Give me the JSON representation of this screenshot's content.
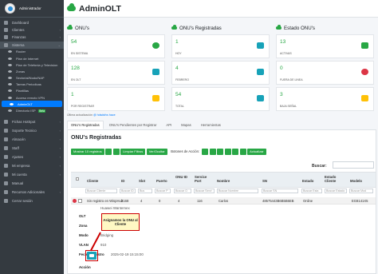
{
  "sidebar": {
    "username": "Administrador",
    "items": [
      {
        "label": "Dashboard",
        "arrow": ""
      },
      {
        "label": "Clientes",
        "arrow": "‹"
      },
      {
        "label": "Finanzas",
        "arrow": "‹"
      },
      {
        "label": "Sistema",
        "arrow": "⌄"
      }
    ],
    "subitems": [
      "Router",
      "Plan de Internet",
      "Plan de Telefonia y Television",
      "Zonas",
      "Sectorial/Nodo/NAP",
      "Tareas Periodicas",
      "Plantillas",
      "Acceso remoto VPN",
      "AdminOLT",
      "Directorio ISP"
    ],
    "directorio_badge": "Beta",
    "bottom_items": [
      {
        "label": "Fichas HotSpot",
        "arrow": "‹"
      },
      {
        "label": "Soporte Tecnico",
        "arrow": "‹"
      },
      {
        "label": "Almacén",
        "arrow": "‹"
      },
      {
        "label": "Staff",
        "arrow": "‹"
      },
      {
        "label": "Ajustes",
        "arrow": "‹"
      },
      {
        "label": "Mi empresa",
        "arrow": "‹"
      },
      {
        "label": "Mi cuenta",
        "arrow": "‹"
      },
      {
        "label": "Manual",
        "arrow": ""
      },
      {
        "label": "Recursos Adicionales",
        "arrow": "‹"
      },
      {
        "label": "Cerrar sesión",
        "arrow": ""
      }
    ]
  },
  "header": {
    "title": "AdminOLT"
  },
  "sections": {
    "onus": {
      "title": "ONU's",
      "cards": [
        {
          "num": "54",
          "label": "En sistema",
          "color": "#28a745"
        },
        {
          "num": "128",
          "label": "En OLT",
          "color": "#28a745"
        },
        {
          "num": "1",
          "label": "Por registrar",
          "color": "#28a745"
        }
      ]
    },
    "registradas": {
      "title": "ONU's Registradas",
      "cards": [
        {
          "num": "1",
          "label": "Hoy",
          "color": "#28a745"
        },
        {
          "num": "4",
          "label": "Febrero",
          "color": "#28a745"
        },
        {
          "num": "54",
          "label": "Total",
          "color": "#28a745"
        }
      ]
    },
    "estado": {
      "title": "Estado ONU's",
      "cards": [
        {
          "num": "13",
          "label": "Activas",
          "color": "#28a745"
        },
        {
          "num": "0",
          "label": "Fuera de linea",
          "color": "#28a745"
        },
        {
          "num": "3",
          "label": "Baja señal",
          "color": "#28a745"
        }
      ]
    }
  },
  "refresh": {
    "prefix": "Última actualización ",
    "link": "@ hdsdsfvs  hace"
  },
  "tabs": [
    "ONU's Registradas",
    "ONU's Pendientes por Registrar",
    "API",
    "Mapas",
    "Herramientas"
  ],
  "panel": {
    "title": "ONU's Registradas",
    "buttons": {
      "show": "Mostrar 10 registros",
      "clear": "Limpiar Filtros",
      "showhide": "Ver/Ocultar",
      "actions_label": "Botones de Acción:",
      "update": "Actualizar"
    },
    "search_label": "Buscar:",
    "headers": [
      "Cliente",
      "ID",
      "Slot",
      "Puerto",
      "ONU ID",
      "Service Port",
      "Nombre",
      "SN",
      "Estado",
      "Estado Cliente",
      "Modelo"
    ],
    "filters": [
      "Buscar Cliente",
      "Buscar ID",
      "Bus",
      "Buscar P",
      "Buscar O",
      "Buscar Servi",
      "Buscar Nombre",
      "Buscar SN",
      "Buscar Esta",
      "Buscar Estado",
      "Buscar Mod"
    ],
    "row": {
      "cliente": "Sin registro en WispHub",
      "id": "2168",
      "slot": "4",
      "puerto": "0",
      "onu_id": "4",
      "service_port": "116",
      "nombre": "Carlos",
      "sn": "48575443B6B5B6EB",
      "estado": "Online",
      "modelo": "EG8141X5"
    },
    "detail": {
      "labels": [
        "OLT",
        "Zona",
        "Modo",
        "VLAN",
        "Fecha Registro",
        "Acción"
      ],
      "values": [
        "Huawei Wantemex",
        "",
        "Bridging",
        "910",
        "2025-02-19 15:15:00",
        ""
      ]
    },
    "callout": "Asignamos la ONU al Cliente"
  }
}
